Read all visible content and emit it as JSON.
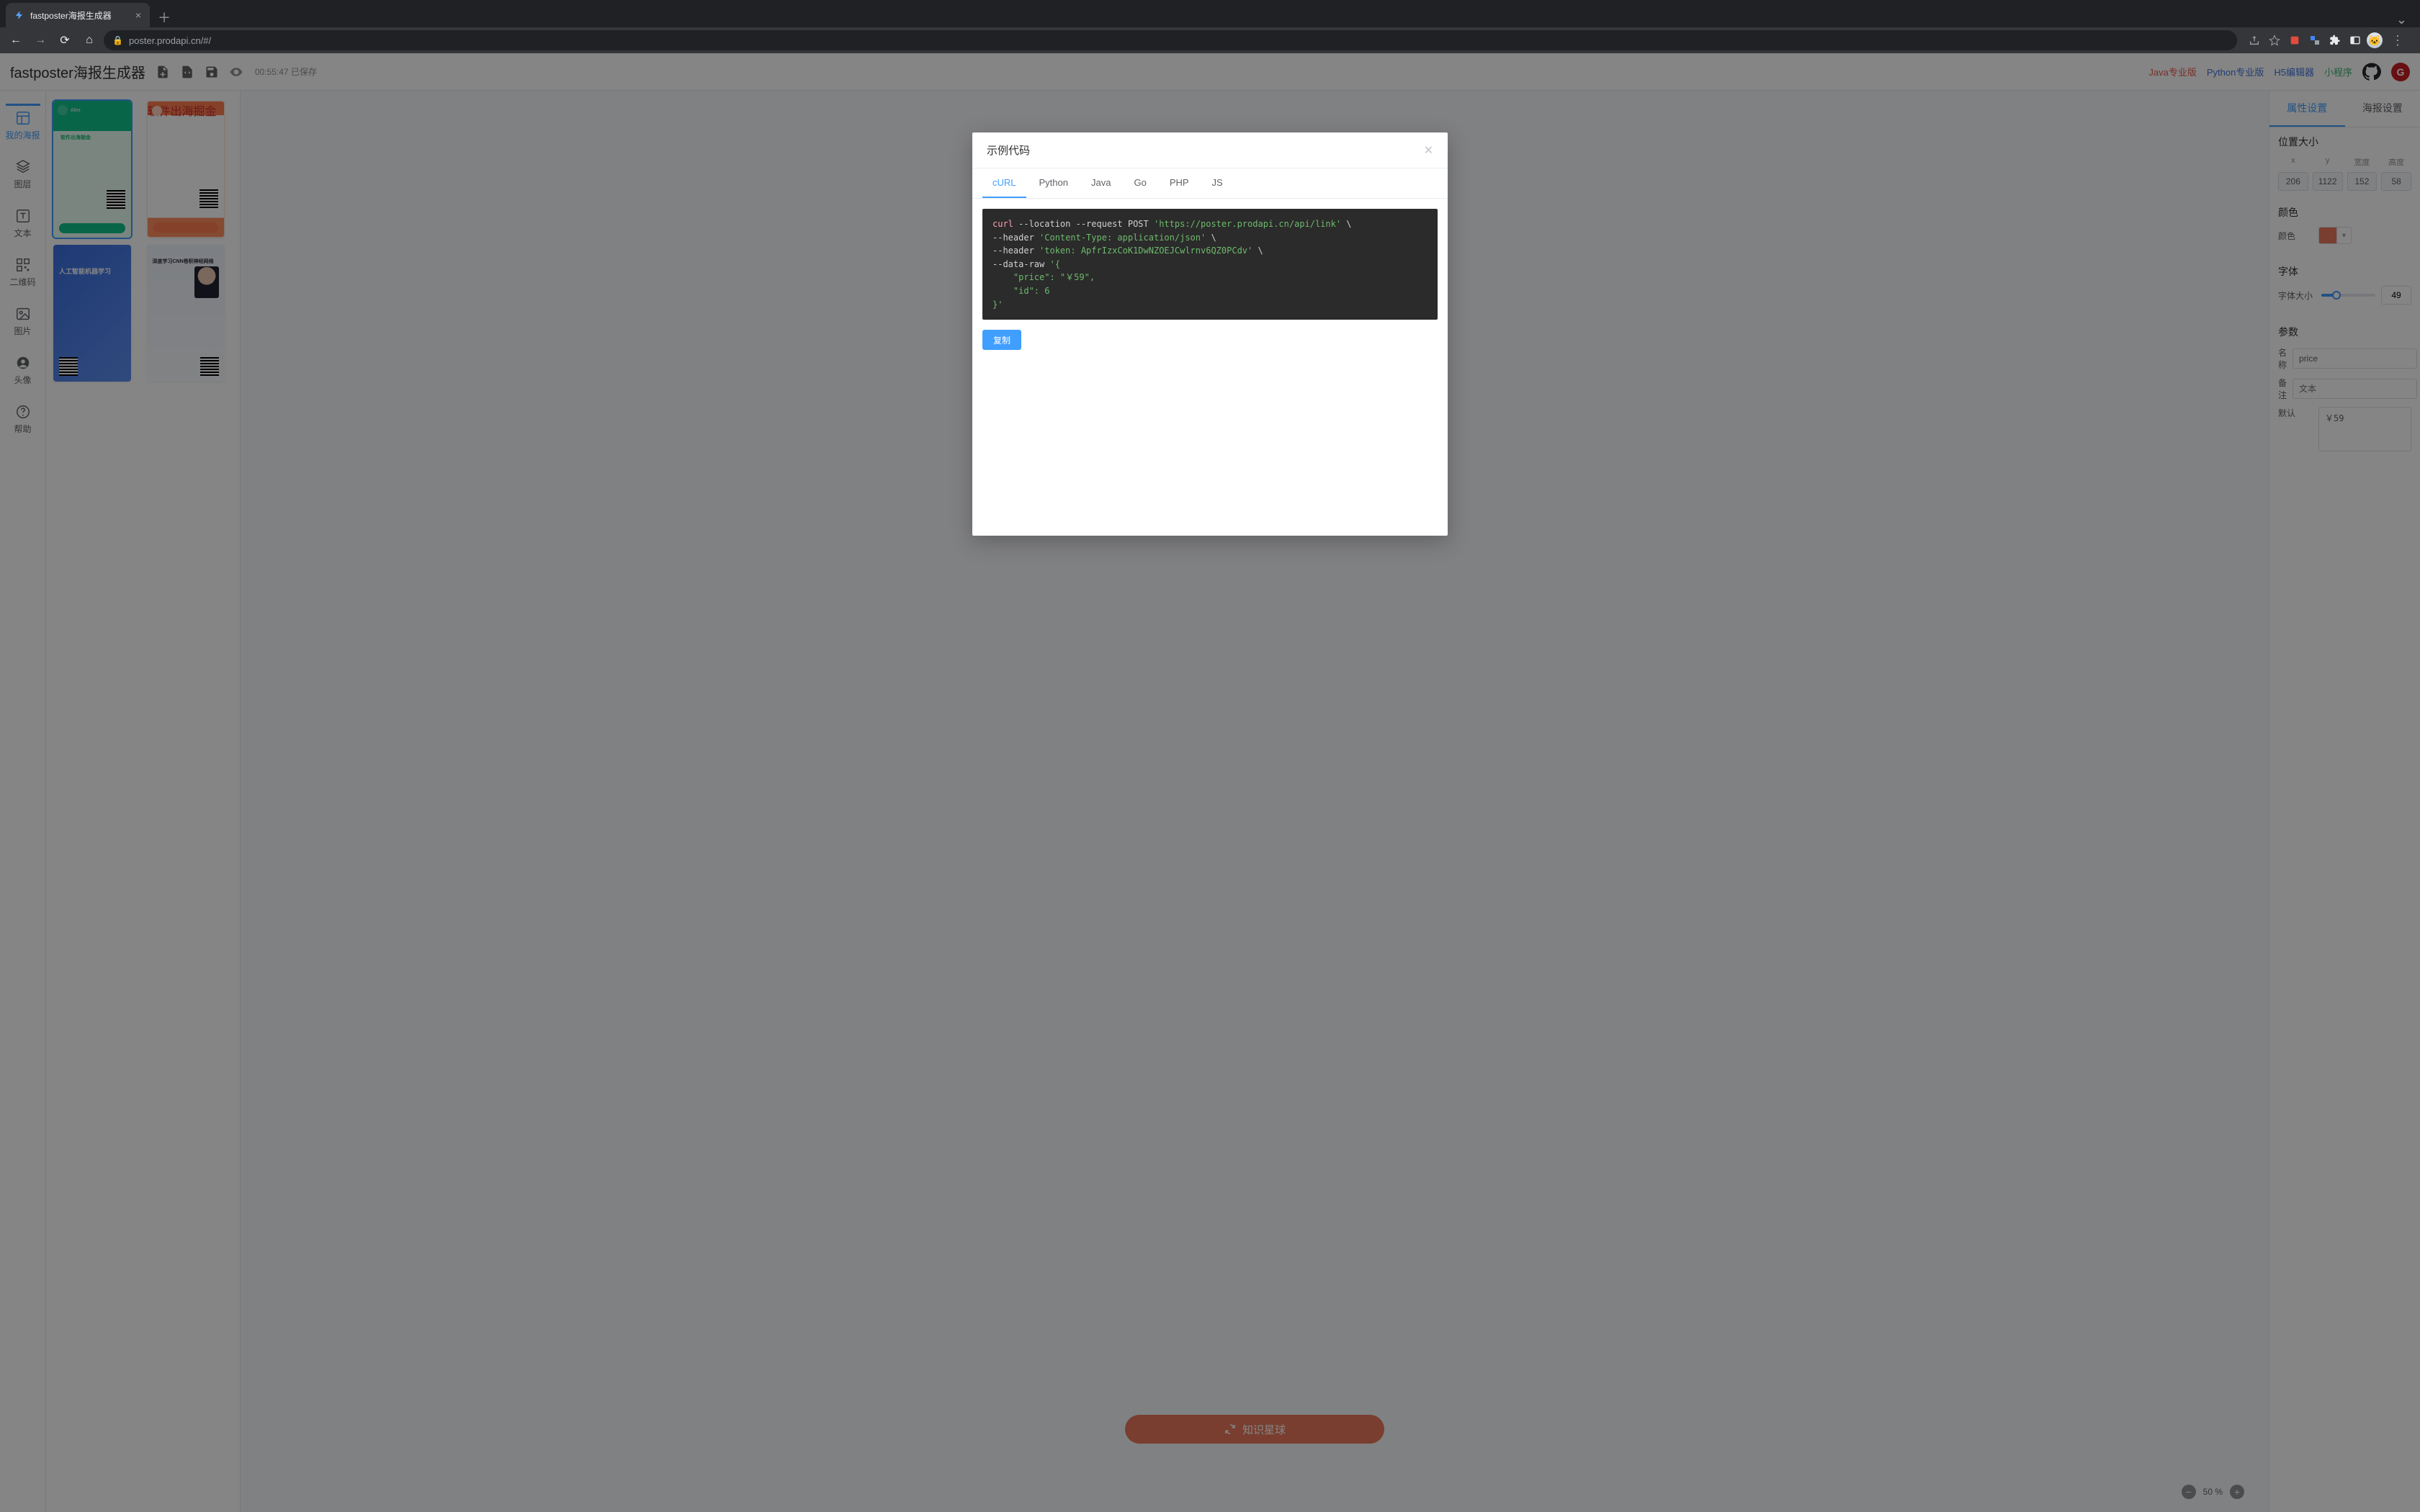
{
  "browser": {
    "tab_title": "fastposter海报生成器",
    "url_display": "poster.prodapi.cn/#/"
  },
  "header": {
    "title": "fastposter海报生成器",
    "status": "00:55:47 已保存",
    "links": {
      "java": "Java专业版",
      "python": "Python专业版",
      "h5": "H5编辑器",
      "mini": "小程序"
    }
  },
  "nav": {
    "my_poster": "我的海报",
    "layer": "图层",
    "text": "文本",
    "qrcode": "二维码",
    "image": "图片",
    "avatar": "头像",
    "help": "帮助"
  },
  "gallery": {
    "thumbs": {
      "0": {
        "title": "软件出海掘金"
      },
      "1": {
        "title": "软件出海掘金"
      },
      "2": {
        "title": "人工智能机器学习"
      },
      "3": {
        "title": "深度学习CNN卷积神经网络"
      }
    }
  },
  "canvas": {
    "cta_label": "知识星球",
    "zoom": {
      "out": "−",
      "value": "50 %",
      "in": "+"
    }
  },
  "panel": {
    "tabs": {
      "props": "属性设置",
      "poster": "海报设置"
    },
    "pos_heading": "位置大小",
    "pos_labels": {
      "x": "x",
      "y": "y",
      "w": "宽度",
      "h": "高度"
    },
    "pos_values": {
      "x": "206",
      "y": "1122",
      "w": "152",
      "h": "58"
    },
    "color_heading": "颜色",
    "color_label": "颜色",
    "color_value": "#E9785A",
    "font_heading": "字体",
    "font_size_label": "字体大小",
    "font_size_value": "49",
    "params_heading": "参数",
    "param_name_label": "名称",
    "param_name_value": "price",
    "param_remark_label": "备注",
    "param_remark_placeholder": "文本",
    "param_default_label": "默认",
    "param_default_value": "￥59"
  },
  "modal": {
    "title": "示例代码",
    "tabs": {
      "curl": "cURL",
      "python": "Python",
      "java": "Java",
      "go": "Go",
      "php": "PHP",
      "js": "JS"
    },
    "copy_label": "复制",
    "code": {
      "cmd": "curl",
      "flags1": " --location --request POST ",
      "url": "'https://poster.prodapi.cn/api/link'",
      "cont1": " \\",
      "h1a": "--header ",
      "h1b": "'Content-Type: application/json'",
      "h1c": " \\",
      "h2a": "--header ",
      "h2b": "'token: ApfrIzxCoK1DwNZOEJCwlrnv6QZ0PCdv'",
      "h2c": " \\",
      "d1": "--data-raw ",
      "d2": "'{",
      "d3": "    \"price\": \"￥59\",",
      "d4": "    \"id\": 6",
      "d5": "}'"
    }
  }
}
